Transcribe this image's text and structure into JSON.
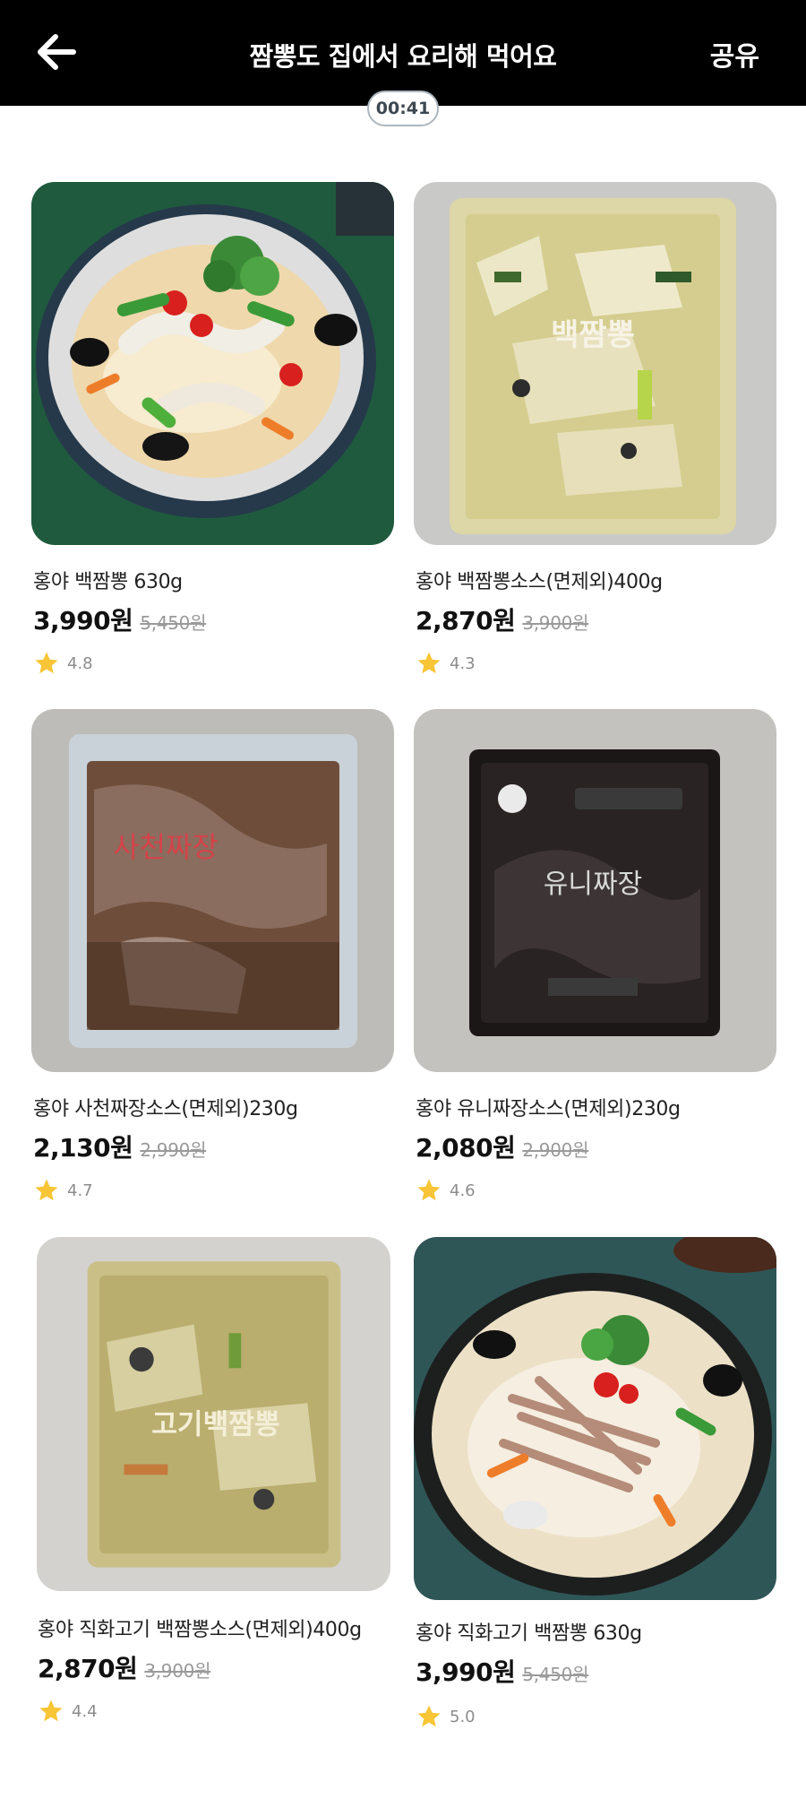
{
  "header": {
    "title": "짬뽕도 집에서 요리해 먹어요",
    "share_label": "공유"
  },
  "timer": "00:41",
  "products": [
    {
      "name": "홍야 백짬뽕 630g",
      "price": "3,990원",
      "original_price": "5,450원",
      "rating": "4.8"
    },
    {
      "name": "홍야 백짬뽕소스(면제외)400g",
      "price": "2,870원",
      "original_price": "3,900원",
      "rating": "4.3"
    },
    {
      "name": "홍야 사천짜장소스(면제외)230g",
      "price": "2,130원",
      "original_price": "2,990원",
      "rating": "4.7",
      "package_text": "사천짜장"
    },
    {
      "name": "홍야 유니짜장소스(면제외)230g",
      "price": "2,080원",
      "original_price": "2,900원",
      "rating": "4.6",
      "package_text": "유니짜장"
    },
    {
      "name": "홍야 직화고기 백짬뽕소스(면제외)400g",
      "price": "2,870원",
      "original_price": "3,900원",
      "rating": "4.4",
      "package_text": "고기백짬뽕"
    },
    {
      "name": "홍야 직화고기 백짬뽕 630g",
      "price": "3,990원",
      "original_price": "5,450원",
      "rating": "5.0"
    }
  ],
  "icons": {
    "back": "arrow-left-icon",
    "star": "star-icon"
  },
  "colors": {
    "header_bg": "#000000",
    "star": "#f7c536",
    "timer_border": "#aeb6bd"
  }
}
